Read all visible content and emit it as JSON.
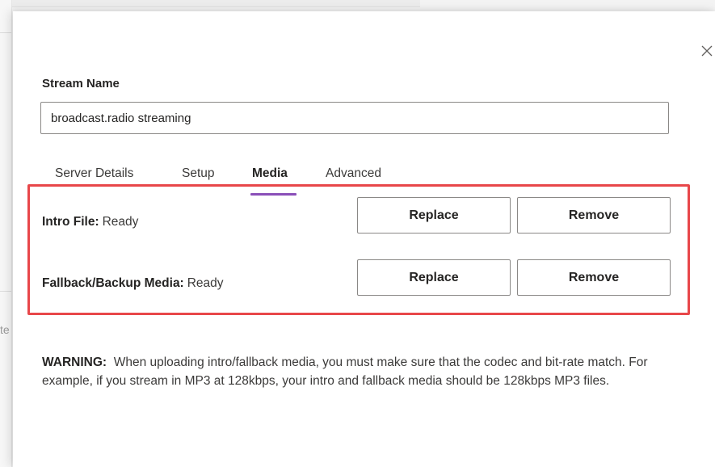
{
  "dialog": {
    "stream_name_label": "Stream Name",
    "stream_name_value": "broadcast.radio streaming",
    "tabs": [
      {
        "label": "Server Details",
        "active": false
      },
      {
        "label": "Setup",
        "active": false
      },
      {
        "label": "Media",
        "active": true
      },
      {
        "label": "Advanced",
        "active": false
      }
    ],
    "media": {
      "intro": {
        "label": "Intro File:",
        "status": "Ready",
        "replace_label": "Replace",
        "remove_label": "Remove"
      },
      "fallback": {
        "label": "Fallback/Backup Media:",
        "status": "Ready",
        "replace_label": "Replace",
        "remove_label": "Remove"
      }
    },
    "warning": {
      "prefix": "WARNING:",
      "text": "When uploading intro/fallback media, you must make sure that the codec and bit-rate match. For example, if you stream in MP3 at 128kbps, your intro and fallback media should be 128kbps MP3 files."
    }
  },
  "background": {
    "partial_text": "te"
  },
  "colors": {
    "active_tab_underline": "#8a4fb8",
    "highlight_border": "#e8474a"
  },
  "icons": {
    "close": "close-icon"
  }
}
